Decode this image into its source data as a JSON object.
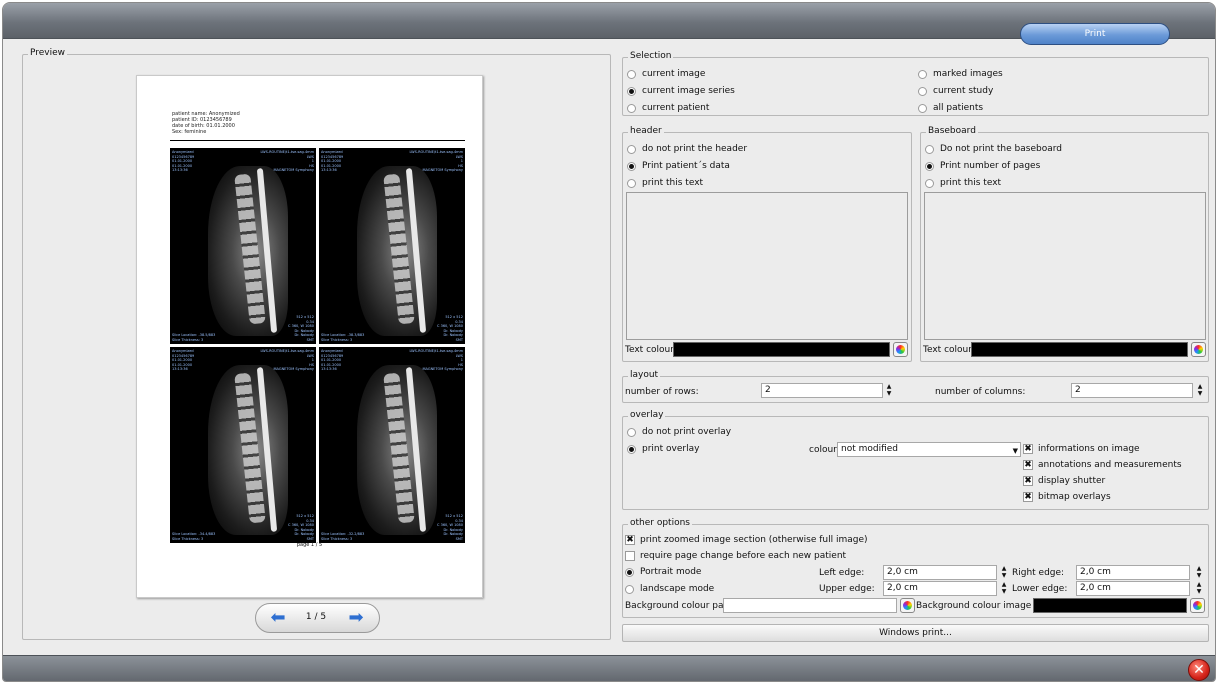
{
  "toolbar": {
    "print_label": "Print"
  },
  "preview": {
    "legend": "Preview",
    "patient_lines": [
      "patient name: Anonymized",
      "patient ID: 0123456789",
      "date of birth: 01.01.2000",
      "Sex: feminine"
    ],
    "page_footer": "page 1 / 5",
    "pager_label": "1 / 5",
    "image_overlay_left": [
      "Anonymized",
      "0123456789",
      "01.01.2000",
      "01.01.2000",
      "13:13:36"
    ],
    "image_overlay_right": [
      "LWS-ROUTINE/t1-tse-sag-4mm",
      "LWS",
      "1",
      "HS",
      "MAGNETOM Symphony"
    ],
    "image_overlay_bottom_right": [
      "512 x 512",
      "0.34",
      "C 360, W 1080",
      "Dr. Nobody",
      "Dr. Nobody",
      "SMT"
    ],
    "image_locations": [
      "Slice Location: -38.5/883",
      "Slice Location: -38.3/883",
      "Slice Location: -34.4/883",
      "Slice Location: -32.2/883"
    ],
    "slice_thickness": "Slice Thickness: 3"
  },
  "selection": {
    "legend": "Selection",
    "options_left": [
      {
        "label": "current image",
        "selected": false
      },
      {
        "label": "current image series",
        "selected": true
      },
      {
        "label": "current patient",
        "selected": false
      }
    ],
    "options_right": [
      {
        "label": "marked images",
        "selected": false
      },
      {
        "label": "current study",
        "selected": false
      },
      {
        "label": "all patients",
        "selected": false
      }
    ]
  },
  "header": {
    "legend": "header",
    "options": [
      {
        "label": "do not print the header",
        "selected": false
      },
      {
        "label": "Print patient´s data",
        "selected": true
      },
      {
        "label": "print this text",
        "selected": false
      }
    ],
    "text_colour_label": "Text colour:",
    "text_colour": "#000000"
  },
  "baseboard": {
    "legend": "Baseboard",
    "options": [
      {
        "label": "Do not print the baseboard",
        "selected": false
      },
      {
        "label": "Print number of pages",
        "selected": true
      },
      {
        "label": "print this text",
        "selected": false
      }
    ],
    "text_colour_label": "Text colour:",
    "text_colour": "#000000"
  },
  "layout": {
    "legend": "layout",
    "rows_label": "number of rows:",
    "rows_value": "2",
    "cols_label": "number of columns:",
    "cols_value": "2"
  },
  "overlay": {
    "legend": "overlay",
    "options": [
      {
        "label": "do not print overlay",
        "selected": false
      },
      {
        "label": "print overlay",
        "selected": true
      }
    ],
    "colour_label": "colour:",
    "colour_value": "not modified",
    "checks": [
      {
        "label": "informations on image",
        "checked": true
      },
      {
        "label": "annotations and measurements",
        "checked": true
      },
      {
        "label": "display shutter",
        "checked": true
      },
      {
        "label": "bitmap overlays",
        "checked": true
      }
    ]
  },
  "other": {
    "legend": "other options",
    "zoom_label": "print zoomed image section (otherwise full image)",
    "zoom_checked": true,
    "page_change_label": "require page change before each new patient",
    "page_change_checked": false,
    "portrait_label": "Portrait mode",
    "portrait_selected": true,
    "landscape_label": "landscape mode",
    "landscape_selected": false,
    "left_edge_label": "Left edge:",
    "left_edge_value": "2,0 cm",
    "right_edge_label": "Right edge:",
    "right_edge_value": "2,0 cm",
    "upper_edge_label": "Upper edge:",
    "upper_edge_value": "2,0 cm",
    "lower_edge_label": "Lower edge:",
    "lower_edge_value": "2,0 cm",
    "bg_page_label": "Background colour page:",
    "bg_page_colour": "#ffffff",
    "bg_box_label": "Background colour image box:",
    "bg_box_colour": "#000000"
  },
  "windows_print_label": "Windows print..."
}
